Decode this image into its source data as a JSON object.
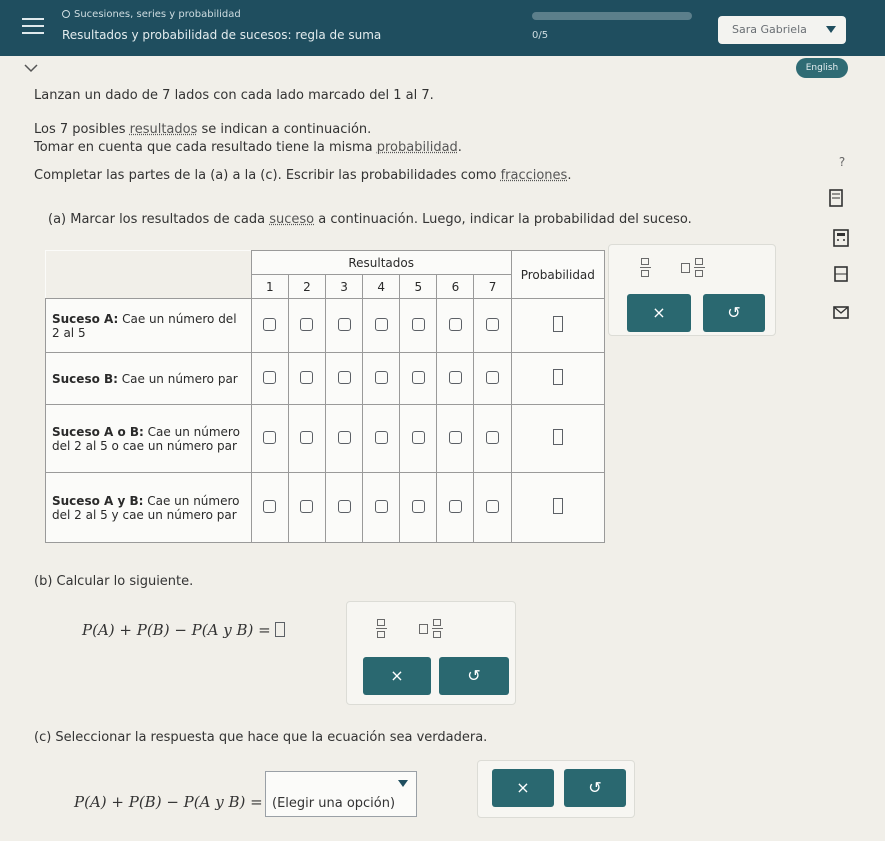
{
  "header": {
    "topic": "Sucesiones, series y probabilidad",
    "title": "Resultados y probabilidad de sucesos: regla de suma",
    "progress_label": "0/5",
    "progress_fraction": 0.0,
    "user_name": "Sara Gabriela",
    "language_button": "English"
  },
  "intro": {
    "line1": "Lanzan un dado de 7 lados con cada lado marcado del 1 al 7.",
    "line2_pre": "Los 7 posibles ",
    "line2_link": "resultados",
    "line2_post": " se indican a continuación.",
    "line3_pre": "Tomar en cuenta que cada resultado tiene la misma ",
    "line3_link": "probabilidad",
    "line3_post": ".",
    "line4_pre": "Completar las partes de la (a) a la (c). Escribir las probabilidades como ",
    "line4_link": "fracciones",
    "line4_post": "."
  },
  "part_a": {
    "prompt_pre": "(a) Marcar los resultados de cada ",
    "prompt_link": "suceso",
    "prompt_post": " a continuación. Luego, indicar la probabilidad del suceso.",
    "header_results": "Resultados",
    "header_prob": "Probabilidad",
    "outcomes": [
      "1",
      "2",
      "3",
      "4",
      "5",
      "6",
      "7"
    ],
    "events": [
      {
        "bold": "Suceso A:",
        "text": " Cae un número del 2 al 5"
      },
      {
        "bold": "Suceso B:",
        "text": " Cae un número par"
      },
      {
        "bold": "Suceso A o B:",
        "text": " Cae un número del 2 al 5 o cae un número par"
      },
      {
        "bold": "Suceso A y B:",
        "text": " Cae un número del 2 al 5 y cae un número par"
      }
    ]
  },
  "part_b": {
    "prompt": "(b) Calcular lo siguiente.",
    "expression": "P(A) + P(B) − P(A y B) ="
  },
  "part_c": {
    "prompt": "(c) Seleccionar la respuesta que hace que la ecuación sea verdadera.",
    "expression": "P(A) + P(B) − P(A y B) =",
    "select_value": "(Elegir una opción)"
  },
  "keypad": {
    "clear": "×",
    "undo": "↺"
  },
  "side": {
    "help": "?"
  }
}
